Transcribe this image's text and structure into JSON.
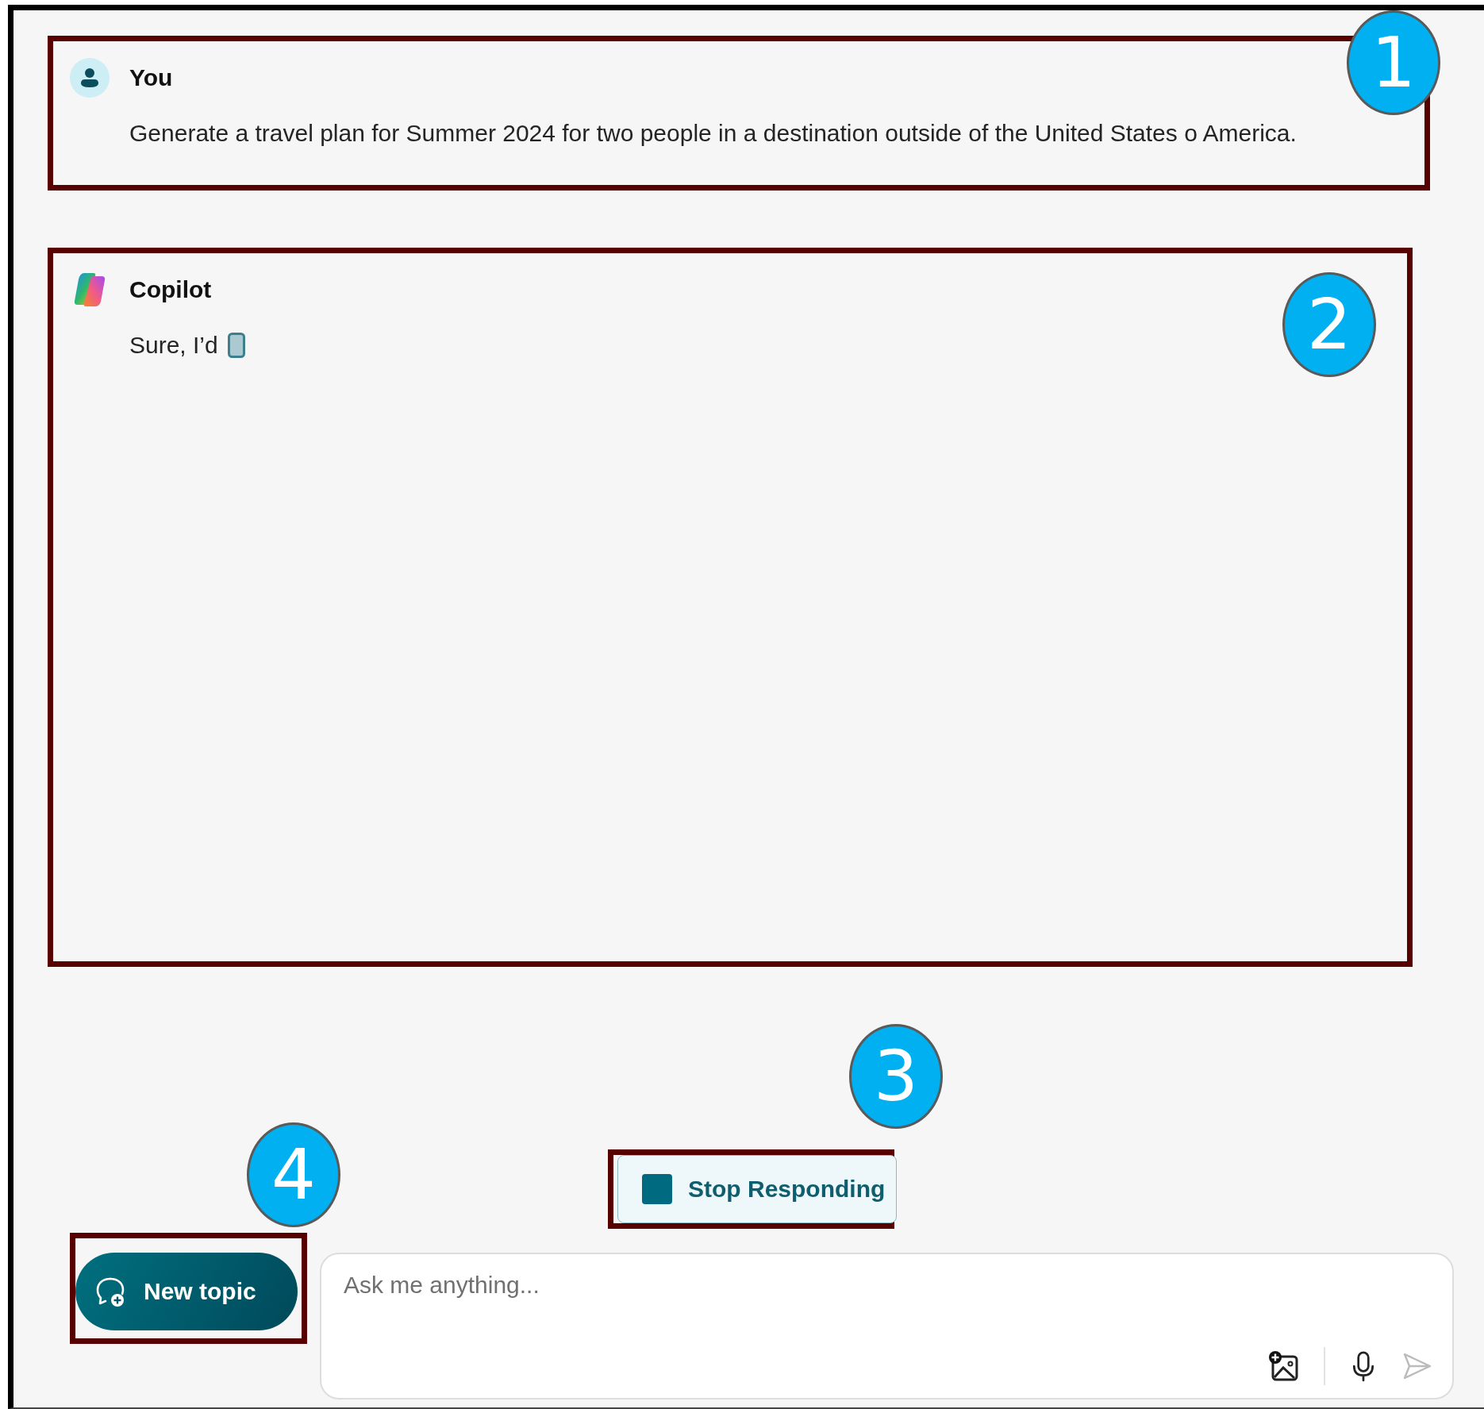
{
  "messages": [
    {
      "kind": "user",
      "author": "You",
      "text": "Generate a travel plan for Summer 2024 for two people in a destination outside of the United States o America.",
      "streaming": false,
      "callout": "1"
    },
    {
      "kind": "bot",
      "author": "Copilot",
      "text": "Sure, I’d",
      "streaming": true,
      "callout": "2"
    }
  ],
  "stop_button": {
    "label": "Stop Responding",
    "callout": "3"
  },
  "new_topic_button": {
    "label": "New topic",
    "callout": "4"
  },
  "input": {
    "placeholder": "Ask me anything..."
  }
}
